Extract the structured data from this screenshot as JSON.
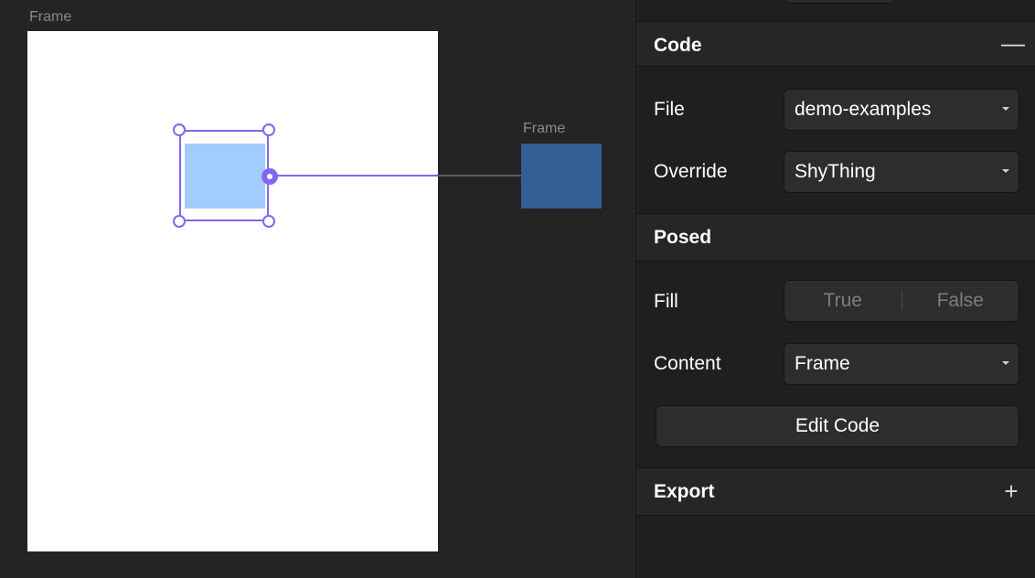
{
  "canvas": {
    "main_frame_label": "Frame",
    "side_frame_label": "Frame",
    "colors": {
      "selection": "#8366f0",
      "shy_thing_fill": "#a1ccfc",
      "side_frame_fill": "#315f94",
      "connector_line": "#8366f0",
      "connector_line_tail": "#5a5a5a"
    }
  },
  "panel": {
    "code": {
      "title": "Code",
      "toggle_icon": "minus-icon",
      "toggle_glyph": "—",
      "file_label": "File",
      "file_value": "demo-examples",
      "override_label": "Override",
      "override_value": "ShyThing"
    },
    "posed": {
      "title": "Posed",
      "fill_label": "Fill",
      "fill_options": [
        "True",
        "False"
      ],
      "content_label": "Content",
      "content_value": "Frame",
      "edit_code_label": "Edit Code"
    },
    "export": {
      "title": "Export",
      "toggle_icon": "plus-icon",
      "toggle_glyph": "+"
    }
  }
}
